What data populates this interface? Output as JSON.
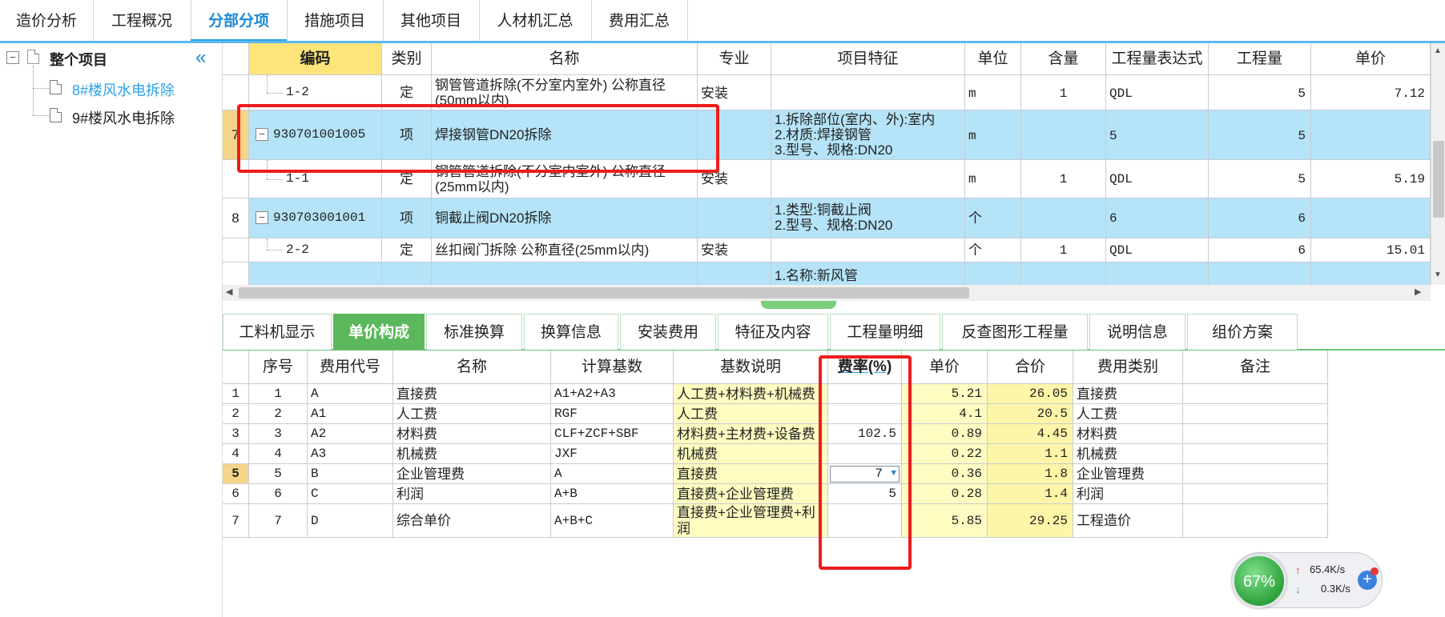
{
  "top_tabs": [
    "造价分析",
    "工程概况",
    "分部分项",
    "措施项目",
    "其他项目",
    "人材机汇总",
    "费用汇总"
  ],
  "tree": {
    "root": "整个项目",
    "children": [
      "8#楼风水电拆除",
      "9#楼风水电拆除"
    ]
  },
  "upper_grid": {
    "headers": [
      "编码",
      "类别",
      "名称",
      "专业",
      "项目特征",
      "单位",
      "含量",
      "工程量表达式",
      "工程量",
      "单价"
    ],
    "rows": [
      {
        "seq": "",
        "code": "1-2",
        "type": "定",
        "name": "钢管管道拆除(不分室内室外) 公称直径(50mm以内)",
        "major": "安装",
        "feature": "",
        "unit": "m",
        "qty_rate": "1",
        "expr": "QDL",
        "qty": "5",
        "price": "7.12"
      },
      {
        "seq": "7",
        "code": "930701001005",
        "type": "项",
        "name": "焊接钢管DN20拆除",
        "major": "",
        "feature": "1.拆除部位(室内、外):室内\n2.材质:焊接钢管\n3.型号、规格:DN20",
        "unit": "m",
        "qty_rate": "",
        "expr": "5",
        "qty": "5",
        "price": ""
      },
      {
        "seq": "",
        "code": "1-1",
        "type": "定",
        "name": "钢管管道拆除(不分室内室外) 公称直径(25mm以内)",
        "major": "安装",
        "feature": "",
        "unit": "m",
        "qty_rate": "1",
        "expr": "QDL",
        "qty": "5",
        "price": "5.19"
      },
      {
        "seq": "8",
        "code": "930703001001",
        "type": "项",
        "name": "铜截止阀DN20拆除",
        "major": "",
        "feature": "1.类型:铜截止阀\n2.型号、规格:DN20",
        "unit": "个",
        "qty_rate": "",
        "expr": "6",
        "qty": "6",
        "price": ""
      },
      {
        "seq": "",
        "code": "2-2",
        "type": "定",
        "name": "丝扣阀门拆除 公称直径(25mm以内)",
        "major": "安装",
        "feature": "",
        "unit": "个",
        "qty_rate": "1",
        "expr": "QDL",
        "qty": "6",
        "price": "15.01"
      },
      {
        "seq": "",
        "code": "",
        "type": "",
        "name": "",
        "major": "",
        "feature": "1.名称:新风管",
        "unit": "",
        "qty_rate": "",
        "expr": "",
        "qty": "",
        "price": ""
      }
    ]
  },
  "lower_tabs": [
    "工料机显示",
    "单价构成",
    "标准换算",
    "换算信息",
    "安装费用",
    "特征及内容",
    "工程量明细",
    "反查图形工程量",
    "说明信息",
    "组价方案"
  ],
  "lower_grid": {
    "headers": [
      "序号",
      "费用代号",
      "名称",
      "计算基数",
      "基数说明",
      "费率(%)",
      "单价",
      "合价",
      "费用类别",
      "备注"
    ],
    "rows": [
      {
        "row": "1",
        "seq": "1",
        "code": "A",
        "name": "直接费",
        "base": "A1+A2+A3",
        "desc": "人工费+材料费+机械费",
        "rate": "",
        "price": "5.21",
        "total": "26.05",
        "cat": "直接费",
        "note": ""
      },
      {
        "row": "2",
        "seq": "2",
        "code": "A1",
        "name": "人工费",
        "base": "RGF",
        "desc": "人工费",
        "rate": "",
        "price": "4.1",
        "total": "20.5",
        "cat": "人工费",
        "note": ""
      },
      {
        "row": "3",
        "seq": "3",
        "code": "A2",
        "name": "材料费",
        "base": "CLF+ZCF+SBF",
        "desc": "材料费+主材费+设备费",
        "rate": "102.5",
        "price": "0.89",
        "total": "4.45",
        "cat": "材料费",
        "note": ""
      },
      {
        "row": "4",
        "seq": "4",
        "code": "A3",
        "name": "机械费",
        "base": "JXF",
        "desc": "机械费",
        "rate": "",
        "price": "0.22",
        "total": "1.1",
        "cat": "机械费",
        "note": ""
      },
      {
        "row": "5",
        "seq": "5",
        "code": "B",
        "name": "企业管理费",
        "base": "A",
        "desc": "直接费",
        "rate": "7",
        "price": "0.36",
        "total": "1.8",
        "cat": "企业管理费",
        "note": ""
      },
      {
        "row": "6",
        "seq": "6",
        "code": "C",
        "name": "利润",
        "base": "A+B",
        "desc": "直接费+企业管理费",
        "rate": "5",
        "price": "0.28",
        "total": "1.4",
        "cat": "利润",
        "note": ""
      },
      {
        "row": "7",
        "seq": "7",
        "code": "D",
        "name": "综合单价",
        "base": "A+B+C",
        "desc": "直接费+企业管理费+利润",
        "rate": "",
        "price": "5.85",
        "total": "29.25",
        "cat": "工程造价",
        "note": ""
      }
    ]
  },
  "net_widget": {
    "percent": "67%",
    "up": "65.4K/s",
    "down": "0.3K/s"
  },
  "colors": {
    "accent_blue": "#2aa3e8",
    "row_blue": "#b5e3f7",
    "tab_green": "#5cb85c",
    "highlight_red": "#ee1c1c",
    "header_yellow": "#ffe47a"
  }
}
